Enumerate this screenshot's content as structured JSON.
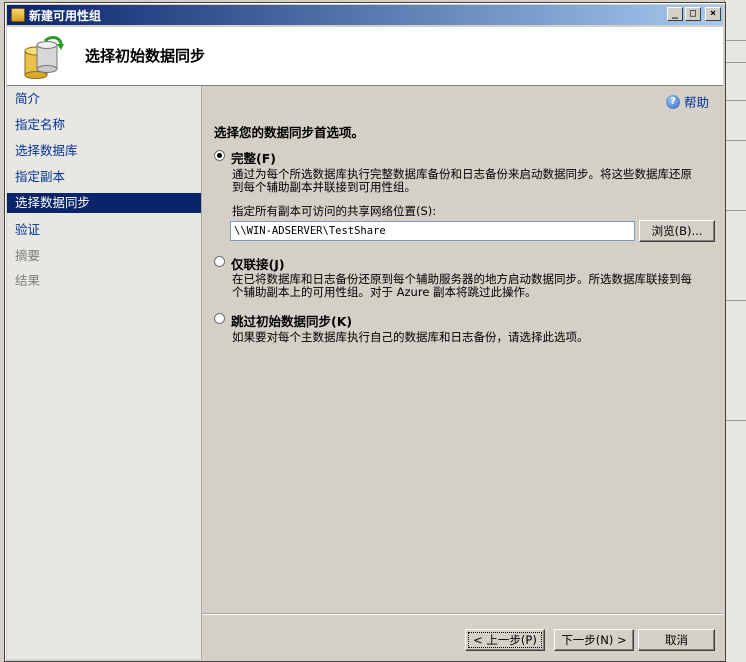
{
  "window": {
    "title": "新建可用性组",
    "min_glyph": "_",
    "max_glyph": "□",
    "close_glyph": "×"
  },
  "header": {
    "title": "选择初始数据同步"
  },
  "sidebar": {
    "items": [
      {
        "label": "简介",
        "state": "link"
      },
      {
        "label": "指定名称",
        "state": "link"
      },
      {
        "label": "选择数据库",
        "state": "link"
      },
      {
        "label": "指定副本",
        "state": "link"
      },
      {
        "label": "选择数据同步",
        "state": "active"
      },
      {
        "label": "验证",
        "state": "link"
      },
      {
        "label": "摘要",
        "state": "disabled"
      },
      {
        "label": "结果",
        "state": "disabled"
      }
    ]
  },
  "help": {
    "label": "帮助",
    "icon_glyph": "?"
  },
  "main": {
    "prompt": "选择您的数据同步首选项。",
    "options": [
      {
        "label": "完整(F)",
        "checked": true,
        "desc_1": "通过为每个所选数据库执行完整数据库备份和日志备份来启动数据同步。将这些数据库还原",
        "desc_2": "到每个辅助副本并联接到可用性组。"
      },
      {
        "label": "仅联接(J)",
        "checked": false,
        "desc_1": "在已将数据库和日志备份还原到每个辅助服务器的地方启动数据同步。所选数据库联接到每",
        "desc_2": "个辅助副本上的可用性组。对于 Azure 副本将跳过此操作。"
      },
      {
        "label": "跳过初始数据同步(K)",
        "checked": false,
        "desc_1": "如果要对每个主数据库执行自己的数据库和日志备份，请选择此选项。"
      }
    ],
    "share_label": "指定所有副本可访问的共享网络位置(S):",
    "share_value": "\\\\WIN-ADSERVER\\TestShare",
    "browse_label": "浏览(B)..."
  },
  "footer": {
    "back_label": "< 上一步(P)",
    "next_label": "下一步(N) >",
    "cancel_label": "取消"
  }
}
